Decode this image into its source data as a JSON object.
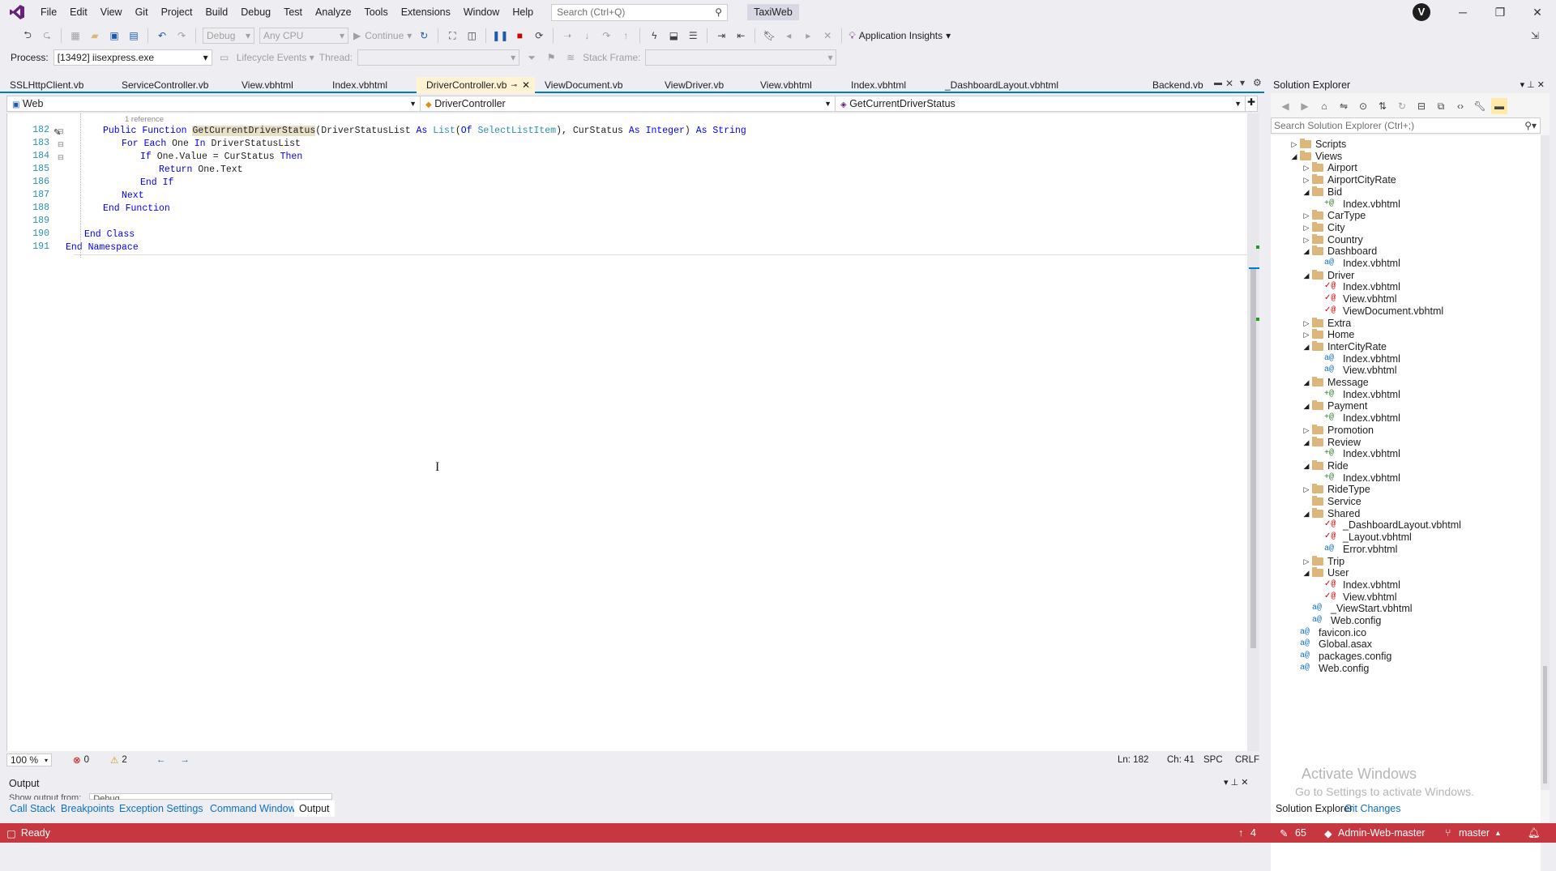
{
  "menu": {
    "items": [
      "File",
      "Edit",
      "View",
      "Git",
      "Project",
      "Build",
      "Debug",
      "Test",
      "Analyze",
      "Tools",
      "Extensions",
      "Window",
      "Help"
    ],
    "search_placeholder": "Search (Ctrl+Q)",
    "solution_name": "TaxiWeb",
    "avatar_letter": "V"
  },
  "toolbar": {
    "config": "Debug",
    "platform": "Any CPU",
    "continue": "Continue",
    "app_insights": "Application Insights",
    "process_label": "Process:",
    "process_value": "[13492] iisexpress.exe",
    "lifecycle": "Lifecycle Events",
    "thread_label": "Thread:",
    "stack_label": "Stack Frame:"
  },
  "tabs": [
    {
      "label": "SSLHttpClient.vb",
      "active": false
    },
    {
      "label": "ServiceController.vb",
      "active": false
    },
    {
      "label": "View.vbhtml",
      "active": false
    },
    {
      "label": "Index.vbhtml",
      "active": false
    },
    {
      "label": "DriverController.vb",
      "active": true
    },
    {
      "label": "ViewDocument.vb",
      "active": false
    },
    {
      "label": "ViewDriver.vb",
      "active": false
    },
    {
      "label": "View.vbhtml",
      "active": false
    },
    {
      "label": "Index.vbhtml",
      "active": false
    },
    {
      "label": "_DashboardLayout.vbhtml",
      "active": false
    },
    {
      "label": "Backend.vb",
      "active": false
    }
  ],
  "navbar": {
    "project": "Web",
    "class": "DriverController",
    "member": "GetCurrentDriverStatus"
  },
  "code": {
    "ref_hint": "1 reference",
    "lines": [
      {
        "num": "182",
        "text": "Public Function GetCurrentDriverStatus(DriverStatusList As List(Of SelectListItem), CurStatus As Integer) As String"
      },
      {
        "num": "183",
        "text": "For Each One In DriverStatusList"
      },
      {
        "num": "184",
        "text": "If One.Value = CurStatus Then"
      },
      {
        "num": "185",
        "text": "Return One.Text"
      },
      {
        "num": "186",
        "text": "End If"
      },
      {
        "num": "187",
        "text": "Next"
      },
      {
        "num": "188",
        "text": "End Function"
      },
      {
        "num": "189",
        "text": ""
      },
      {
        "num": "190",
        "text": "End Class"
      },
      {
        "num": "191",
        "text": "End Namespace"
      }
    ]
  },
  "editor_status": {
    "zoom": "100 %",
    "errors": "0",
    "warnings": "2",
    "ln": "Ln: 182",
    "ch": "Ch: 41",
    "spc": "SPC",
    "crlf": "CRLF"
  },
  "output": {
    "title": "Output",
    "show_from": "Show output from:",
    "source": "Debug"
  },
  "bottom_tabs": [
    "Call Stack",
    "Breakpoints",
    "Exception Settings",
    "Command Window",
    "Output"
  ],
  "statusbar": {
    "ready": "Ready",
    "up_count": "4",
    "edit_count": "65",
    "repo": "Admin-Web-master",
    "branch": "master"
  },
  "solution_explorer": {
    "title": "Solution Explorer",
    "search_placeholder": "Search Solution Explorer (Ctrl+;)",
    "tabs": [
      "Solution Explorer",
      "Git Changes"
    ],
    "watermark_line1": "Activate Windows",
    "watermark_line2": "Go to Settings to activate Windows.",
    "tree": [
      {
        "label": "Scripts",
        "type": "folder",
        "level": 2,
        "expand": "collapsed"
      },
      {
        "label": "Views",
        "type": "folder",
        "level": 2,
        "expand": "expanded"
      },
      {
        "label": "Airport",
        "type": "folder",
        "level": 3,
        "expand": "collapsed"
      },
      {
        "label": "AirportCityRate",
        "type": "folder",
        "level": 3,
        "expand": "collapsed"
      },
      {
        "label": "Bid",
        "type": "folder",
        "level": 3,
        "expand": "expanded"
      },
      {
        "label": "Index.vbhtml",
        "type": "file",
        "level": 4,
        "status": "add"
      },
      {
        "label": "CarType",
        "type": "folder",
        "level": 3,
        "expand": "collapsed"
      },
      {
        "label": "City",
        "type": "folder",
        "level": 3,
        "expand": "collapsed"
      },
      {
        "label": "Country",
        "type": "folder",
        "level": 3,
        "expand": "collapsed"
      },
      {
        "label": "Dashboard",
        "type": "folder",
        "level": 3,
        "expand": "expanded"
      },
      {
        "label": "Index.vbhtml",
        "type": "file",
        "level": 4,
        "status": "lock"
      },
      {
        "label": "Driver",
        "type": "folder",
        "level": 3,
        "expand": "expanded"
      },
      {
        "label": "Index.vbhtml",
        "type": "file",
        "level": 4,
        "status": "mod"
      },
      {
        "label": "View.vbhtml",
        "type": "file",
        "level": 4,
        "status": "mod"
      },
      {
        "label": "ViewDocument.vbhtml",
        "type": "file",
        "level": 4,
        "status": "mod"
      },
      {
        "label": "Extra",
        "type": "folder",
        "level": 3,
        "expand": "collapsed"
      },
      {
        "label": "Home",
        "type": "folder",
        "level": 3,
        "expand": "collapsed"
      },
      {
        "label": "InterCityRate",
        "type": "folder",
        "level": 3,
        "expand": "expanded"
      },
      {
        "label": "Index.vbhtml",
        "type": "file",
        "level": 4,
        "status": "lock"
      },
      {
        "label": "View.vbhtml",
        "type": "file",
        "level": 4,
        "status": "lock"
      },
      {
        "label": "Message",
        "type": "folder",
        "level": 3,
        "expand": "expanded"
      },
      {
        "label": "Index.vbhtml",
        "type": "file",
        "level": 4,
        "status": "add"
      },
      {
        "label": "Payment",
        "type": "folder",
        "level": 3,
        "expand": "expanded"
      },
      {
        "label": "Index.vbhtml",
        "type": "file",
        "level": 4,
        "status": "add"
      },
      {
        "label": "Promotion",
        "type": "folder",
        "level": 3,
        "expand": "collapsed"
      },
      {
        "label": "Review",
        "type": "folder",
        "level": 3,
        "expand": "expanded"
      },
      {
        "label": "Index.vbhtml",
        "type": "file",
        "level": 4,
        "status": "add"
      },
      {
        "label": "Ride",
        "type": "folder",
        "level": 3,
        "expand": "expanded"
      },
      {
        "label": "Index.vbhtml",
        "type": "file",
        "level": 4,
        "status": "add"
      },
      {
        "label": "RideType",
        "type": "folder",
        "level": 3,
        "expand": "collapsed"
      },
      {
        "label": "Service",
        "type": "folder",
        "level": 3,
        "expand": "none"
      },
      {
        "label": "Shared",
        "type": "folder",
        "level": 3,
        "expand": "expanded"
      },
      {
        "label": "_DashboardLayout.vbhtml",
        "type": "file",
        "level": 4,
        "status": "mod"
      },
      {
        "label": "_Layout.vbhtml",
        "type": "file",
        "level": 4,
        "status": "mod"
      },
      {
        "label": "Error.vbhtml",
        "type": "file",
        "level": 4,
        "status": "lock"
      },
      {
        "label": "Trip",
        "type": "folder",
        "level": 3,
        "expand": "collapsed"
      },
      {
        "label": "User",
        "type": "folder",
        "level": 3,
        "expand": "expanded"
      },
      {
        "label": "Index.vbhtml",
        "type": "file",
        "level": 4,
        "status": "mod"
      },
      {
        "label": "View.vbhtml",
        "type": "file",
        "level": 4,
        "status": "mod"
      },
      {
        "label": "_ViewStart.vbhtml",
        "type": "file",
        "level": 3,
        "status": "lock"
      },
      {
        "label": "Web.config",
        "type": "file",
        "level": 3,
        "status": "lock"
      },
      {
        "label": "favicon.ico",
        "type": "file",
        "level": 2,
        "status": "lock"
      },
      {
        "label": "Global.asax",
        "type": "file",
        "level": 2,
        "status": "lock"
      },
      {
        "label": "packages.config",
        "type": "file",
        "level": 2,
        "status": "lock"
      },
      {
        "label": "Web.config",
        "type": "file",
        "level": 2,
        "status": "lock"
      }
    ]
  },
  "colors": {
    "accent": "#007acc",
    "statusbar": "#c7373f",
    "active_tab": "#fff3d3",
    "keyword": "#0000ff",
    "type": "#2b91af",
    "line_number": "#2b91af"
  }
}
